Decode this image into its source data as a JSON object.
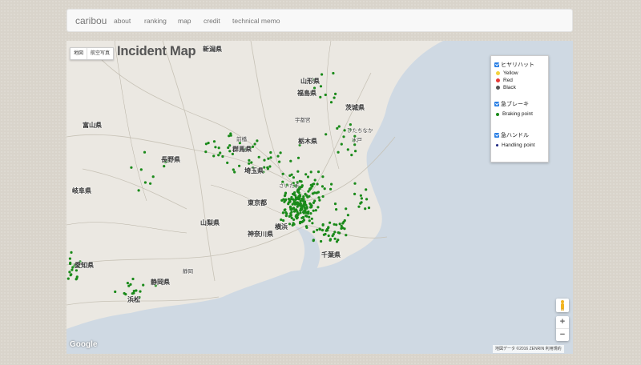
{
  "navbar": {
    "brand": "caribou",
    "items": [
      {
        "label": "about"
      },
      {
        "label": "ranking"
      },
      {
        "label": "map"
      },
      {
        "label": "credit"
      },
      {
        "label": "technical memo"
      }
    ]
  },
  "map": {
    "title": "Incident Map",
    "map_type_buttons": [
      "地図",
      "航空写真"
    ],
    "legend": {
      "groups": [
        {
          "name": "ヒヤリハット",
          "checked": true,
          "items": [
            {
              "label": "Yellow",
              "color": "#f3d23c"
            },
            {
              "label": "Red",
              "color": "#e53935"
            },
            {
              "label": "Black",
              "color": "#555555"
            }
          ]
        },
        {
          "name": "急ブレーキ",
          "checked": true,
          "items": [
            {
              "label": "Braking point",
              "color": "#1a8a1a"
            }
          ]
        },
        {
          "name": "急ハンドル",
          "checked": true,
          "items": [
            {
              "label": "Handling point",
              "color": "#1a237e"
            }
          ]
        }
      ]
    },
    "zoom_in": "+",
    "zoom_out": "−",
    "google_logo": "Google",
    "attribution": "地図データ ©2016 ZENRIN   利用規約",
    "places": [
      {
        "name": "新潟県"
      },
      {
        "name": "山形県"
      },
      {
        "name": "福島県"
      },
      {
        "name": "栃木県"
      },
      {
        "name": "茨城県"
      },
      {
        "name": "群馬県"
      },
      {
        "name": "長野県"
      },
      {
        "name": "埼玉県"
      },
      {
        "name": "東京都"
      },
      {
        "name": "千葉県"
      },
      {
        "name": "神奈川県"
      },
      {
        "name": "山梨県"
      },
      {
        "name": "静岡県"
      },
      {
        "name": "富山県"
      },
      {
        "name": "岐阜県"
      },
      {
        "name": "愛知県"
      },
      {
        "name": "横浜"
      },
      {
        "name": "浜松"
      },
      {
        "name": "静岡"
      },
      {
        "name": "宇都宮"
      },
      {
        "name": "水戸"
      },
      {
        "name": "前橋"
      },
      {
        "name": "さいたま"
      },
      {
        "name": "ひたちなか"
      }
    ],
    "colors": {
      "braking": "#1a8a1a",
      "sea": "#cfd9e3",
      "land": "#ebe8e2"
    }
  }
}
